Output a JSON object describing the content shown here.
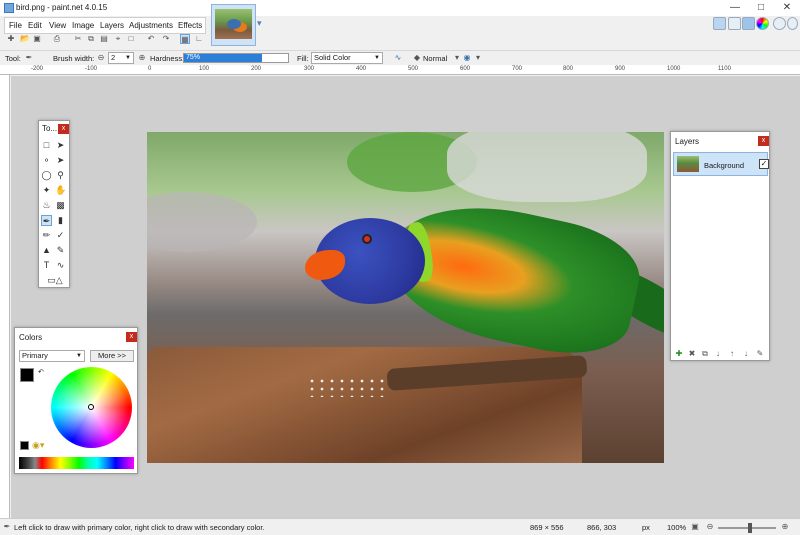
{
  "window": {
    "title": "bird.png - paint.net 4.0.15"
  },
  "menu": [
    "File",
    "Edit",
    "View",
    "Image",
    "Layers",
    "Adjustments",
    "Effects"
  ],
  "toolbar": {
    "tool_label": "Tool:",
    "brush_width_label": "Brush width:",
    "brush_width_value": "2",
    "hardness_label": "Hardness:",
    "hardness_value": "75%",
    "hardness_percent": 75,
    "fill_label": "Fill:",
    "fill_value": "Solid Color",
    "blend_mode": "Normal"
  },
  "ruler": {
    "h_ticks": [
      "-200",
      "-100",
      "0",
      "100",
      "200",
      "300",
      "400",
      "500",
      "600",
      "700",
      "800",
      "900",
      "1000",
      "1100"
    ]
  },
  "tools_panel": {
    "title": "To...",
    "close": "x"
  },
  "colors_panel": {
    "title": "Colors",
    "close": "x",
    "mode": "Primary",
    "more_button": "More >>",
    "primary_color": "#000000",
    "secondary_color": "#ffffff"
  },
  "layers_panel": {
    "title": "Layers",
    "close": "x",
    "layers": [
      {
        "name": "Background",
        "visible": true
      }
    ]
  },
  "status": {
    "hint": "Left click to draw with primary color, right click to draw with secondary color.",
    "image_size": "869 × 556",
    "cursor_pos": "866, 303",
    "unit": "px",
    "zoom": "100%"
  },
  "colors": {
    "accent": "#2b7fd8",
    "close_red": "#c42b1c",
    "selection": "#cde3f8"
  }
}
